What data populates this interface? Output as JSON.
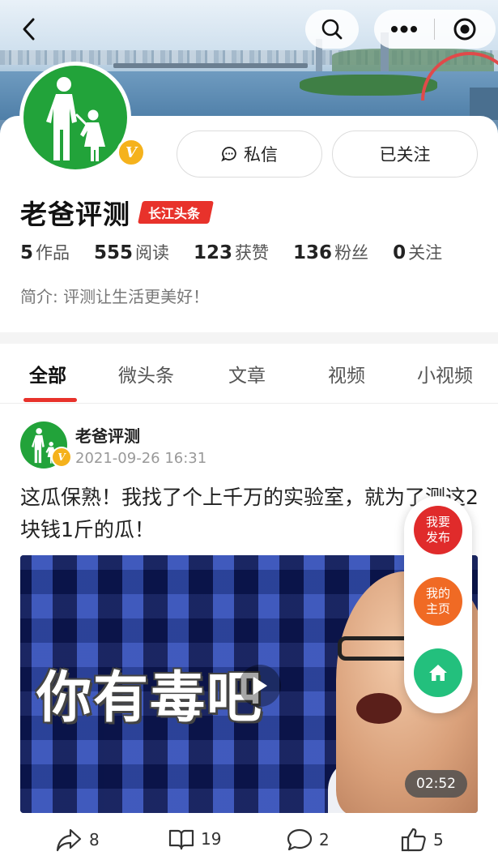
{
  "header": {
    "back_icon": "chevron-left-icon",
    "search_icon": "search-icon",
    "more_icon": "more-dots-icon",
    "target_icon": "target-icon"
  },
  "profile": {
    "name": "老爸评测",
    "tag": "长江头条",
    "verified_badge": "V",
    "message_button": "私信",
    "follow_button": "已关注",
    "stats": [
      {
        "num": "5",
        "label": "作品"
      },
      {
        "num": "555",
        "label": "阅读"
      },
      {
        "num": "123",
        "label": "获赞"
      },
      {
        "num": "136",
        "label": "粉丝"
      },
      {
        "num": "0",
        "label": "关注"
      }
    ],
    "bio": "简介: 评测让生活更美好！"
  },
  "tabs": [
    {
      "label": "全部",
      "active": true
    },
    {
      "label": "微头条",
      "active": false
    },
    {
      "label": "文章",
      "active": false
    },
    {
      "label": "视频",
      "active": false
    },
    {
      "label": "小视频",
      "active": false
    }
  ],
  "post": {
    "author": "老爸评测",
    "time": "2021-09-26 16:31",
    "title": "这瓜保熟！我找了个上千万的实验室，就为了测这2块钱1斤的瓜！",
    "video_overlay_text": "你有毒吧",
    "duration": "02:52",
    "actions": {
      "share": "8",
      "read": "19",
      "comment": "2",
      "like": "5"
    }
  },
  "floating": {
    "publish": "我要\n发布",
    "my_home": "我的\n主页",
    "home_icon": "home-icon"
  },
  "colors": {
    "accent": "#e8322b",
    "avatar_green": "#22a33a",
    "verified": "#f5b21c",
    "home_green": "#23c07d",
    "orange": "#f06a24"
  }
}
